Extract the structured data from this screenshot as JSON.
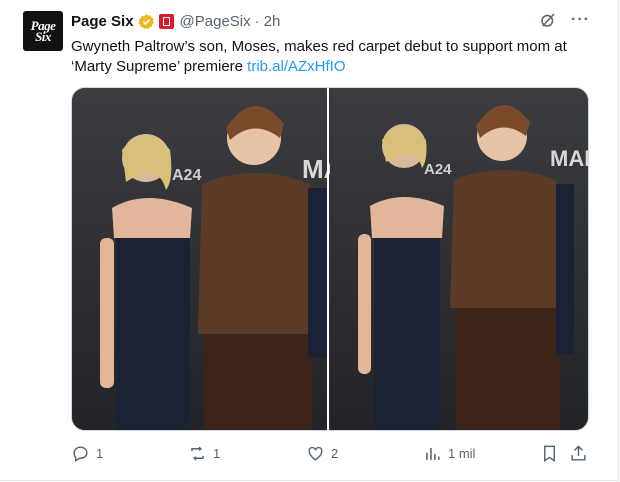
{
  "post": {
    "author_name": "Page Six",
    "avatar_text_line1": "Page",
    "avatar_text_line2": "Six",
    "handle": "@PageSix",
    "separator": "·",
    "time": "2h",
    "text": "Gwyneth Paltrow’s son, Moses, makes red carpet debut to support mom at ‘Marty Supreme’ premiere ",
    "link_text": "trib.al/AZxHfIO"
  },
  "media": {
    "backdrop_text_1": "MARY SUPRE",
    "backdrop_text_2": "A24"
  },
  "actions": {
    "replies": "1",
    "reposts": "1",
    "likes": "2",
    "views": "1 mil"
  },
  "colors": {
    "accent": "#1d9bf0",
    "muted": "#536471",
    "verified_gold": "#e8b923",
    "affiliate_red": "#d71f2a"
  },
  "icons": [
    "grok-icon",
    "more-icon",
    "reply-icon",
    "repost-icon",
    "like-icon",
    "views-icon",
    "bookmark-icon",
    "share-icon"
  ]
}
